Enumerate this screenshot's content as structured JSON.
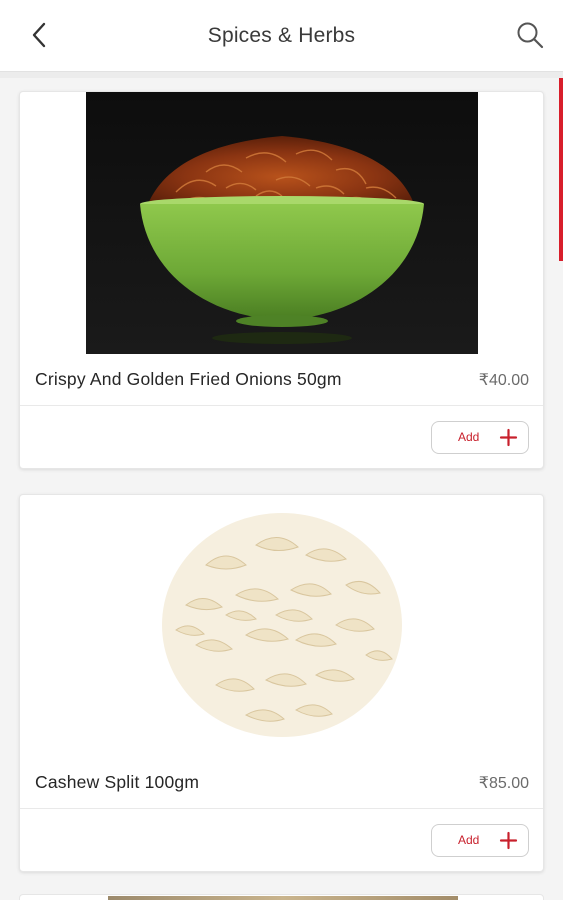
{
  "header": {
    "title": "Spices & Herbs",
    "back_icon": "chevron-left-icon",
    "search_icon": "search-icon"
  },
  "products": [
    {
      "name": "Crispy And Golden Fried Onions 50gm",
      "price": "₹40.00",
      "add_label": "Add",
      "image": "fried-onions-in-green-bowl"
    },
    {
      "name": "Cashew Split 100gm",
      "price": "₹85.00",
      "add_label": "Add",
      "image": "cashew-split-pile"
    }
  ],
  "colors": {
    "accent": "#d81e2b",
    "header_bg": "#ffffff",
    "page_bg": "#f4f4f4"
  }
}
